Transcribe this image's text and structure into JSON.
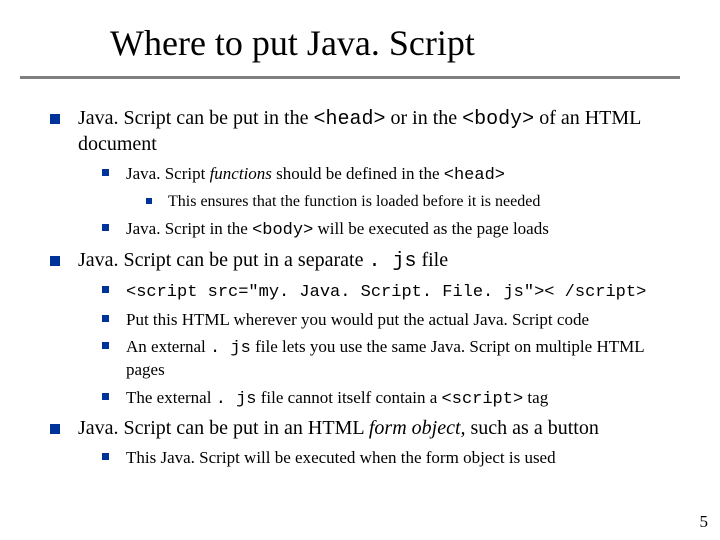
{
  "title": "Where to put Java. Script",
  "bullets": {
    "b1": {
      "pre": "Java. Script can be put in the ",
      "head": "<head>",
      "mid": " or in the ",
      "body": "<body>",
      "post": " of an HTML document",
      "s1": {
        "pre": "Java. Script ",
        "fn": "functions",
        "mid": " should be defined in the ",
        "head": "<head>",
        "sub1": "This ensures that the function is loaded before it is needed"
      },
      "s2": {
        "pre": "Java. Script in the ",
        "body": "<body>",
        "post": " will be executed as the page loads"
      }
    },
    "b2": {
      "pre": "Java. Script can be put in a separate ",
      "js": ". js",
      "post": " file",
      "s1": "<script src=\"my. Java. Script. File. js\">< /script>",
      "s2": "Put this HTML wherever you would put the actual Java. Script code",
      "s3": {
        "pre": "An external ",
        "js": ". js",
        "post": " file lets you use the same Java. Script on multiple HTML pages"
      },
      "s4": {
        "pre": "The external ",
        "js": ". js",
        "mid": " file cannot itself contain a ",
        "tag": "<script>",
        "post": " tag"
      }
    },
    "b3": {
      "pre": "Java. Script can be put in an HTML ",
      "form": "form object,",
      "post": " such as a button",
      "s1": "This Java. Script will be executed when the form object is used"
    }
  },
  "pagenum": "5"
}
